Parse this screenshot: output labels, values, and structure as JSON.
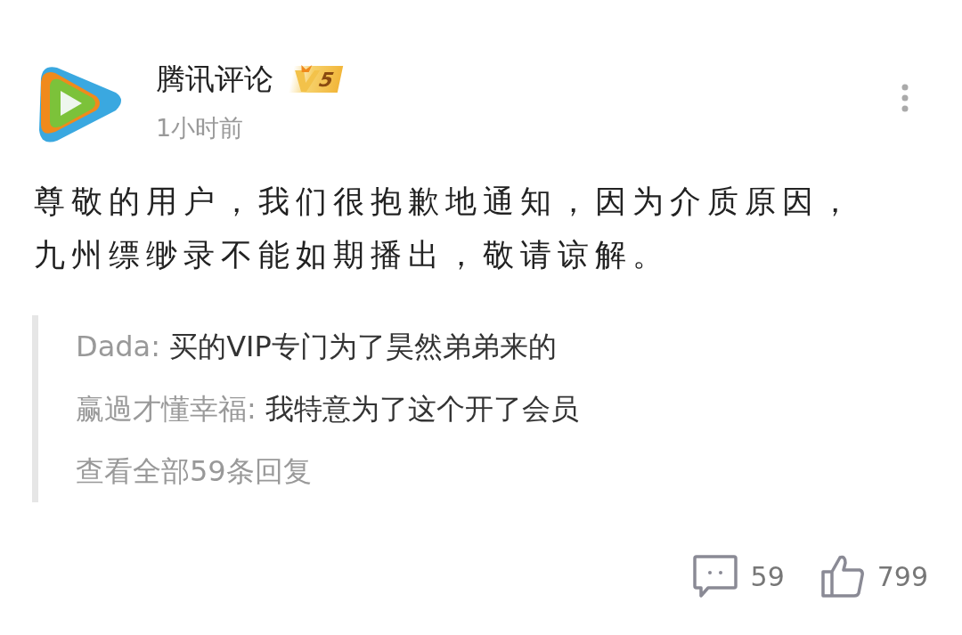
{
  "author": {
    "name": "腾讯评论",
    "level_badge": "5",
    "time": "1小时前"
  },
  "comment": "尊敬的用户，我们很抱歉地通知，因为介质原因，九州缥缈录不能如期播出，敬请谅解。",
  "replies": [
    {
      "user": "Dada:",
      "text": "买的VIP专门为了昊然弟弟来的"
    },
    {
      "user": "赢過才懂幸福:",
      "text": "我特意为了这个开了会员"
    }
  ],
  "view_all": "查看全部59条回复",
  "actions": {
    "comments": "59",
    "likes": "799"
  }
}
